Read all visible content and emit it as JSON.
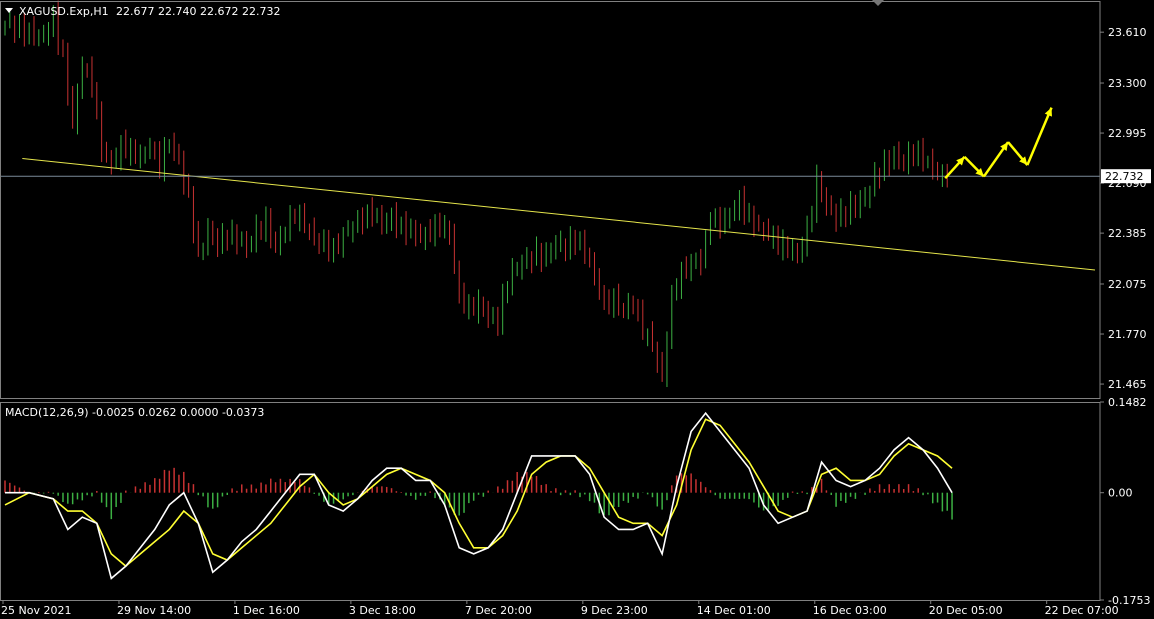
{
  "chart_data": [
    {
      "type": "candlestick",
      "panel": "price",
      "symbol_header": "XAGUSD.Exp,H1",
      "ohlc_header": "22.677 22.740 22.672 22.732",
      "ylim": [
        21.38,
        23.8
      ],
      "y_ticks": [
        "23.610",
        "23.300",
        "22.995",
        "22.690",
        "22.385",
        "22.075",
        "21.770",
        "21.465"
      ],
      "y_tick_values": [
        23.61,
        23.3,
        22.995,
        22.69,
        22.385,
        22.075,
        21.77,
        21.465
      ],
      "current_price_label": "22.732",
      "current_price": 22.732,
      "close_path": [
        [
          0,
          23.66
        ],
        [
          4,
          23.62
        ],
        [
          8,
          23.58
        ],
        [
          10,
          23.7
        ],
        [
          12,
          23.45
        ],
        [
          14,
          23.05
        ],
        [
          16,
          23.42
        ],
        [
          18,
          23.3
        ],
        [
          20,
          22.9
        ],
        [
          22,
          22.8
        ],
        [
          24,
          22.92
        ],
        [
          26,
          22.88
        ],
        [
          28,
          22.85
        ],
        [
          30,
          22.92
        ],
        [
          32,
          22.8
        ],
        [
          34,
          22.95
        ],
        [
          36,
          22.82
        ],
        [
          38,
          22.6
        ],
        [
          40,
          22.25
        ],
        [
          42,
          22.4
        ],
        [
          44,
          22.32
        ],
        [
          46,
          22.38
        ],
        [
          48,
          22.35
        ],
        [
          50,
          22.3
        ],
        [
          52,
          22.4
        ],
        [
          54,
          22.45
        ],
        [
          56,
          22.3
        ],
        [
          58,
          22.42
        ],
        [
          60,
          22.5
        ],
        [
          62,
          22.44
        ],
        [
          64,
          22.35
        ],
        [
          66,
          22.32
        ],
        [
          68,
          22.28
        ],
        [
          70,
          22.38
        ],
        [
          72,
          22.42
        ],
        [
          74,
          22.48
        ],
        [
          76,
          22.52
        ],
        [
          78,
          22.44
        ],
        [
          80,
          22.48
        ],
        [
          82,
          22.42
        ],
        [
          84,
          22.4
        ],
        [
          86,
          22.36
        ],
        [
          88,
          22.4
        ],
        [
          90,
          22.44
        ],
        [
          92,
          22.38
        ],
        [
          94,
          22.0
        ],
        [
          96,
          21.92
        ],
        [
          98,
          21.95
        ],
        [
          100,
          21.88
        ],
        [
          102,
          21.85
        ],
        [
          104,
          22.1
        ],
        [
          106,
          22.18
        ],
        [
          108,
          22.22
        ],
        [
          110,
          22.26
        ],
        [
          112,
          22.24
        ],
        [
          114,
          22.33
        ],
        [
          116,
          22.3
        ],
        [
          118,
          22.35
        ],
        [
          120,
          22.28
        ],
        [
          122,
          22.12
        ],
        [
          124,
          21.95
        ],
        [
          126,
          21.98
        ],
        [
          128,
          21.92
        ],
        [
          130,
          21.96
        ],
        [
          132,
          21.8
        ],
        [
          134,
          21.7
        ],
        [
          136,
          21.5
        ],
        [
          138,
          22.0
        ],
        [
          140,
          22.15
        ],
        [
          142,
          22.2
        ],
        [
          144,
          22.22
        ],
        [
          146,
          22.48
        ],
        [
          148,
          22.44
        ],
        [
          150,
          22.5
        ],
        [
          152,
          22.58
        ],
        [
          154,
          22.48
        ],
        [
          156,
          22.42
        ],
        [
          158,
          22.38
        ],
        [
          160,
          22.32
        ],
        [
          162,
          22.3
        ],
        [
          164,
          22.25
        ],
        [
          166,
          22.4
        ],
        [
          168,
          22.7
        ],
        [
          170,
          22.55
        ],
        [
          172,
          22.48
        ],
        [
          174,
          22.52
        ],
        [
          176,
          22.56
        ],
        [
          178,
          22.6
        ],
        [
          180,
          22.72
        ],
        [
          182,
          22.8
        ],
        [
          184,
          22.86
        ],
        [
          186,
          22.82
        ],
        [
          188,
          22.88
        ],
        [
          190,
          22.85
        ],
        [
          192,
          22.78
        ],
        [
          194,
          22.72
        ]
      ],
      "forecast_arrow_points": [
        [
          195,
          22.72
        ],
        [
          199,
          22.85
        ],
        [
          203,
          22.73
        ],
        [
          208,
          22.94
        ],
        [
          212,
          22.8
        ],
        [
          217,
          23.15
        ]
      ],
      "trendline": {
        "start": [
          4,
          22.84
        ],
        "end": [
          226,
          22.16
        ]
      }
    },
    {
      "type": "macd",
      "panel": "indicator",
      "header": "MACD(12,26,9) -0.0025 0.0262 0.0000 -0.0373",
      "ylim": [
        -0.1753,
        0.1482
      ],
      "y_ticks": [
        "0.1482",
        "0.00",
        "-0.1753"
      ],
      "y_tick_values": [
        0.1482,
        0.0,
        -0.1753
      ],
      "main_line": [
        [
          0,
          0.0
        ],
        [
          5,
          0.0
        ],
        [
          10,
          -0.01
        ],
        [
          13,
          -0.06
        ],
        [
          16,
          -0.04
        ],
        [
          19,
          -0.05
        ],
        [
          22,
          -0.14
        ],
        [
          25,
          -0.12
        ],
        [
          28,
          -0.09
        ],
        [
          31,
          -0.06
        ],
        [
          34,
          -0.02
        ],
        [
          37,
          0.0
        ],
        [
          40,
          -0.05
        ],
        [
          43,
          -0.13
        ],
        [
          46,
          -0.11
        ],
        [
          49,
          -0.08
        ],
        [
          52,
          -0.06
        ],
        [
          55,
          -0.03
        ],
        [
          58,
          0.0
        ],
        [
          61,
          0.03
        ],
        [
          64,
          0.03
        ],
        [
          67,
          -0.02
        ],
        [
          70,
          -0.03
        ],
        [
          73,
          -0.01
        ],
        [
          76,
          0.02
        ],
        [
          79,
          0.04
        ],
        [
          82,
          0.04
        ],
        [
          85,
          0.02
        ],
        [
          88,
          0.02
        ],
        [
          91,
          -0.02
        ],
        [
          94,
          -0.09
        ],
        [
          97,
          -0.1
        ],
        [
          100,
          -0.09
        ],
        [
          103,
          -0.06
        ],
        [
          106,
          0.0
        ],
        [
          109,
          0.06
        ],
        [
          112,
          0.06
        ],
        [
          115,
          0.06
        ],
        [
          118,
          0.06
        ],
        [
          121,
          0.03
        ],
        [
          124,
          -0.04
        ],
        [
          127,
          -0.06
        ],
        [
          130,
          -0.06
        ],
        [
          133,
          -0.05
        ],
        [
          136,
          -0.1
        ],
        [
          139,
          0.01
        ],
        [
          142,
          0.1
        ],
        [
          145,
          0.13
        ],
        [
          148,
          0.1
        ],
        [
          151,
          0.07
        ],
        [
          154,
          0.04
        ],
        [
          157,
          -0.02
        ],
        [
          160,
          -0.05
        ],
        [
          163,
          -0.04
        ],
        [
          166,
          -0.03
        ],
        [
          169,
          0.05
        ],
        [
          172,
          0.02
        ],
        [
          175,
          0.01
        ],
        [
          178,
          0.02
        ],
        [
          181,
          0.04
        ],
        [
          184,
          0.07
        ],
        [
          187,
          0.09
        ],
        [
          190,
          0.07
        ],
        [
          193,
          0.04
        ],
        [
          196,
          0.0
        ]
      ],
      "signal_line": [
        [
          0,
          -0.02
        ],
        [
          5,
          0.0
        ],
        [
          10,
          -0.01
        ],
        [
          13,
          -0.03
        ],
        [
          16,
          -0.03
        ],
        [
          19,
          -0.05
        ],
        [
          22,
          -0.1
        ],
        [
          25,
          -0.12
        ],
        [
          28,
          -0.1
        ],
        [
          31,
          -0.08
        ],
        [
          34,
          -0.06
        ],
        [
          37,
          -0.03
        ],
        [
          40,
          -0.05
        ],
        [
          43,
          -0.1
        ],
        [
          46,
          -0.11
        ],
        [
          49,
          -0.09
        ],
        [
          52,
          -0.07
        ],
        [
          55,
          -0.05
        ],
        [
          58,
          -0.02
        ],
        [
          61,
          0.01
        ],
        [
          64,
          0.03
        ],
        [
          67,
          0.0
        ],
        [
          70,
          -0.02
        ],
        [
          73,
          -0.01
        ],
        [
          76,
          0.01
        ],
        [
          79,
          0.03
        ],
        [
          82,
          0.04
        ],
        [
          85,
          0.03
        ],
        [
          88,
          0.02
        ],
        [
          91,
          0.0
        ],
        [
          94,
          -0.05
        ],
        [
          97,
          -0.09
        ],
        [
          100,
          -0.09
        ],
        [
          103,
          -0.07
        ],
        [
          106,
          -0.03
        ],
        [
          109,
          0.03
        ],
        [
          112,
          0.05
        ],
        [
          115,
          0.06
        ],
        [
          118,
          0.06
        ],
        [
          121,
          0.04
        ],
        [
          124,
          0.0
        ],
        [
          127,
          -0.04
        ],
        [
          130,
          -0.05
        ],
        [
          133,
          -0.05
        ],
        [
          136,
          -0.07
        ],
        [
          139,
          -0.02
        ],
        [
          142,
          0.07
        ],
        [
          145,
          0.12
        ],
        [
          148,
          0.11
        ],
        [
          151,
          0.08
        ],
        [
          154,
          0.05
        ],
        [
          157,
          0.01
        ],
        [
          160,
          -0.03
        ],
        [
          163,
          -0.04
        ],
        [
          166,
          -0.03
        ],
        [
          169,
          0.03
        ],
        [
          172,
          0.04
        ],
        [
          175,
          0.02
        ],
        [
          178,
          0.02
        ],
        [
          181,
          0.03
        ],
        [
          184,
          0.06
        ],
        [
          187,
          0.08
        ],
        [
          190,
          0.07
        ],
        [
          193,
          0.06
        ],
        [
          196,
          0.04
        ]
      ],
      "histogram": [
        [
          0,
          0.02
        ],
        [
          5,
          0.0
        ],
        [
          10,
          0.0
        ],
        [
          13,
          -0.02
        ],
        [
          16,
          -0.01
        ],
        [
          19,
          0.0
        ],
        [
          22,
          -0.04
        ],
        [
          25,
          0.0
        ],
        [
          28,
          0.01
        ],
        [
          31,
          0.02
        ],
        [
          34,
          0.04
        ],
        [
          37,
          0.03
        ],
        [
          40,
          0.0
        ],
        [
          43,
          -0.03
        ],
        [
          46,
          0.0
        ],
        [
          49,
          0.01
        ],
        [
          52,
          0.01
        ],
        [
          55,
          0.02
        ],
        [
          58,
          0.02
        ],
        [
          61,
          0.02
        ],
        [
          64,
          0.0
        ],
        [
          67,
          -0.02
        ],
        [
          70,
          -0.01
        ],
        [
          73,
          0.0
        ],
        [
          76,
          0.01
        ],
        [
          79,
          0.01
        ],
        [
          82,
          0.0
        ],
        [
          85,
          -0.01
        ],
        [
          88,
          0.0
        ],
        [
          91,
          -0.02
        ],
        [
          94,
          -0.04
        ],
        [
          97,
          -0.01
        ],
        [
          100,
          0.0
        ],
        [
          103,
          0.01
        ],
        [
          106,
          0.03
        ],
        [
          109,
          0.03
        ],
        [
          112,
          0.01
        ],
        [
          115,
          0.0
        ],
        [
          118,
          0.0
        ],
        [
          121,
          -0.01
        ],
        [
          124,
          -0.04
        ],
        [
          127,
          -0.02
        ],
        [
          130,
          -0.01
        ],
        [
          133,
          0.0
        ],
        [
          136,
          -0.03
        ],
        [
          139,
          0.03
        ],
        [
          142,
          0.03
        ],
        [
          145,
          0.01
        ],
        [
          148,
          -0.01
        ],
        [
          151,
          -0.01
        ],
        [
          154,
          -0.01
        ],
        [
          157,
          -0.03
        ],
        [
          160,
          -0.02
        ],
        [
          163,
          0.0
        ],
        [
          166,
          0.0
        ],
        [
          169,
          0.02
        ],
        [
          172,
          -0.02
        ],
        [
          175,
          -0.01
        ],
        [
          178,
          0.0
        ],
        [
          181,
          0.01
        ],
        [
          184,
          0.01
        ],
        [
          187,
          0.01
        ],
        [
          190,
          0.0
        ],
        [
          193,
          -0.02
        ],
        [
          196,
          -0.04
        ]
      ]
    }
  ],
  "x_axis": {
    "labels": [
      "25 Nov 2021",
      "29 Nov 14:00",
      "1 Dec 16:00",
      "3 Dec 18:00",
      "7 Dec 20:00",
      "9 Dec 23:00",
      "14 Dec 01:00",
      "16 Dec 03:00",
      "20 Dec 05:00",
      "22 Dec 07:00"
    ],
    "label_bar_index": [
      0,
      24,
      48,
      72,
      96,
      120,
      144,
      168,
      192,
      216
    ],
    "bar_count": 226
  },
  "colors": {
    "background": "#000000",
    "bull": "#3cb043",
    "bear": "#c83232",
    "macd_main": "#ffffff",
    "macd_signal": "#ffff33",
    "trendline": "#e6e64c",
    "arrow": "#ffff00",
    "grid": "#808080",
    "text": "#ffffff"
  }
}
